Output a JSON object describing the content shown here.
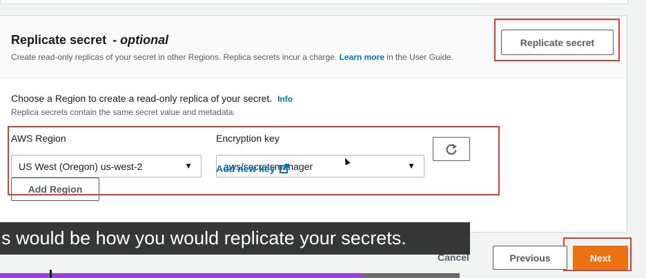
{
  "section": {
    "title": "Replicate secret",
    "title_optional": "- optional",
    "description_prefix": "Create read-only replicas of your secret in other Regions. Replica secrets incur a charge.",
    "description_link": "Learn more",
    "description_suffix": "in the User Guide.",
    "replicate_button": "Replicate secret"
  },
  "region_form": {
    "prompt": "Choose a Region to create a read-only replica of your secret.",
    "info_link": "Info",
    "sub_description": "Replica secrets contain the same secret value and metadata.",
    "aws_region_label": "AWS Region",
    "aws_region_value": "US West (Oregon) us-west-2",
    "encryption_key_label": "Encryption key",
    "encryption_key_value": "aws/secretsmanager",
    "add_new_key": "Add new key",
    "add_region_button": "Add Region"
  },
  "footer": {
    "cancel": "Cancel",
    "previous": "Previous",
    "next": "Next"
  },
  "caption": {
    "text": "s would be how you would replicate your secrets."
  },
  "video": {
    "progress_fraction": 0.79
  },
  "colors": {
    "highlight": "#e8372c",
    "primary_button": "#ec7211",
    "link": "#0073bb",
    "progress": "#9b3fe0"
  },
  "icons": {
    "refresh": "refresh-icon",
    "external_link": "external-link-icon",
    "dropdown": "caret-down-icon"
  }
}
